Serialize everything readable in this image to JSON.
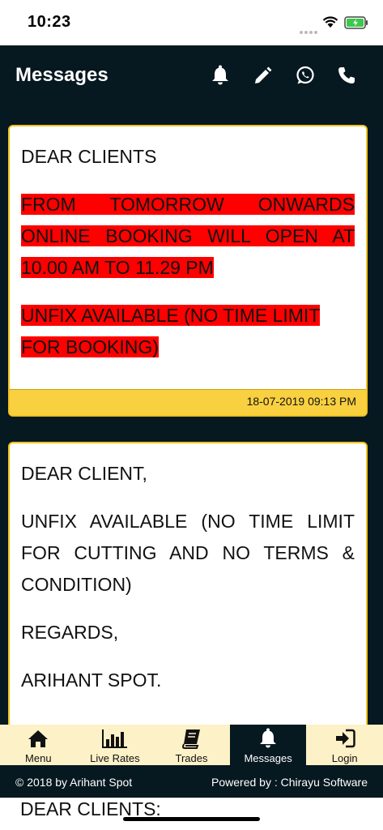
{
  "status_bar": {
    "time": "10:23"
  },
  "header": {
    "title": "Messages",
    "icons": [
      "bell-icon",
      "pencil-icon",
      "whatsapp-icon",
      "phone-icon"
    ]
  },
  "messages": [
    {
      "greeting": "DEAR CLIENTS",
      "highlight_1": "FROM TOMORROW ONWARDS ONLINE BOOKING WILL OPEN AT 10.00 AM TO 11.29 PM",
      "highlight_2": "UNFIX AVAILABLE (NO TIME LIMIT FOR BOOKING)",
      "timestamp": "18-07-2019 09:13 PM"
    },
    {
      "greeting": "DEAR CLIENT,",
      "body": "UNFIX AVAILABLE (NO TIME LIMIT FOR CUTTING AND NO TERMS & CONDITION)",
      "regards": "REGARDS,",
      "signature": "ARIHANT SPOT."
    }
  ],
  "next_message_peek": "DEAR CLIENTS:",
  "bottom_nav": {
    "items": [
      {
        "label": "Menu",
        "icon": "home-icon",
        "active": false
      },
      {
        "label": "Live Rates",
        "icon": "bar-chart-icon",
        "active": false
      },
      {
        "label": "Trades",
        "icon": "book-icon",
        "active": false
      },
      {
        "label": "Messages",
        "icon": "bell-icon",
        "active": true
      },
      {
        "label": "Login",
        "icon": "login-icon",
        "active": false
      }
    ]
  },
  "footer": {
    "copyright": "© 2018 by Arihant Spot",
    "powered_by": "Powered by : Chirayu Software"
  },
  "colors": {
    "header_bg": "#061820",
    "card_border": "#f2c21c",
    "card_footer": "#f9d040",
    "highlight": "#ff0000",
    "nav_bg": "#fdf1c8"
  }
}
